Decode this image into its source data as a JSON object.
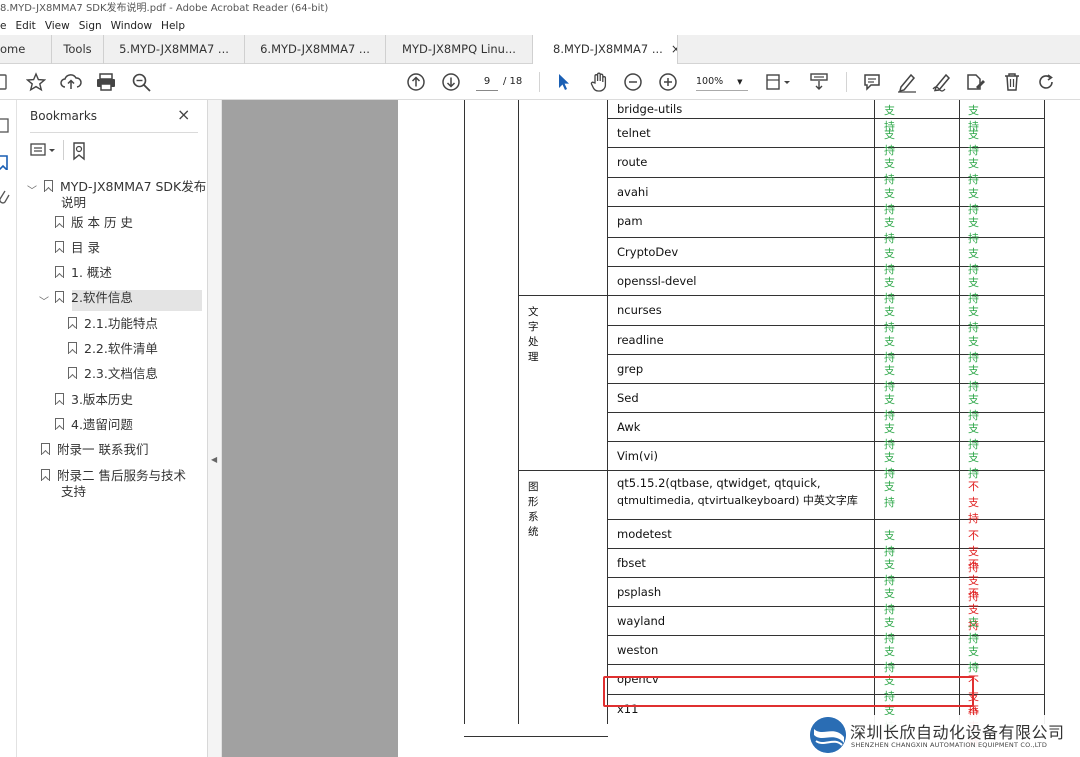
{
  "window": {
    "title": "8.MYD-JX8MMA7 SDK发布说明.pdf - Adobe Acrobat Reader (64-bit)"
  },
  "menu": [
    "e",
    "Edit",
    "View",
    "Sign",
    "Window",
    "Help"
  ],
  "tabs": [
    {
      "label": "ome"
    },
    {
      "label": "Tools"
    },
    {
      "label": "5.MYD-JX8MMA7 ..."
    },
    {
      "label": "6.MYD-JX8MMA7 ..."
    },
    {
      "label": "MYD-JX8MPQ Linu..."
    },
    {
      "label": "8.MYD-JX8MMA7 ..."
    }
  ],
  "tab_close": "×",
  "toolbar": {
    "page_current": "9",
    "page_total": "/ 18",
    "zoom": "100%"
  },
  "bookmarks": {
    "title": "Bookmarks",
    "close": "×",
    "items": [
      {
        "label": "MYD-JX8MMA7 SDK发布"
      },
      {
        "label": "说明"
      },
      {
        "label": "版 本 历 史"
      },
      {
        "label": "目 录"
      },
      {
        "label": "1. 概述"
      },
      {
        "label": "2.软件信息"
      },
      {
        "label": "2.1.功能特点"
      },
      {
        "label": "2.2.软件清单"
      },
      {
        "label": "2.3.文档信息"
      },
      {
        "label": "3.版本历史"
      },
      {
        "label": "4.遗留问题"
      },
      {
        "label": "附录一 联系我们"
      },
      {
        "label": "附录二 售后服务与技术"
      },
      {
        "label": "支持"
      }
    ]
  },
  "table": {
    "categories": [
      "文字处理",
      "图形系统"
    ],
    "rows": [
      {
        "name": "bridge-utils",
        "a": "支持",
        "b": "支持"
      },
      {
        "name": "telnet",
        "a": "支持",
        "b": "支持"
      },
      {
        "name": "route",
        "a": "支持",
        "b": "支持"
      },
      {
        "name": "avahi",
        "a": "支持",
        "b": "支持"
      },
      {
        "name": "pam",
        "a": "支持",
        "b": "支持"
      },
      {
        "name": "CryptoDev",
        "a": "支持",
        "b": "支持"
      },
      {
        "name": "openssl-devel",
        "a": "支持",
        "b": "支持"
      },
      {
        "name": "ncurses",
        "a": "支持",
        "b": "支持"
      },
      {
        "name": "readline",
        "a": "支持",
        "b": "支持"
      },
      {
        "name": "grep",
        "a": "支持",
        "b": "支持"
      },
      {
        "name": "Sed",
        "a": "支持",
        "b": "支持"
      },
      {
        "name": "Awk",
        "a": "支持",
        "b": "支持"
      },
      {
        "name": "Vim(vi)",
        "a": "支持",
        "b": "支持"
      },
      {
        "name": "qt5.15.2(qtbase, qtwidget, qtquick,",
        "name2": "qtmultimedia, qtvirtualkeyboard) 中英文字库",
        "a": "支持",
        "b": "不支持"
      },
      {
        "name": "modetest",
        "a": "支持",
        "b": "不支持"
      },
      {
        "name": "fbset",
        "a": "支持",
        "b": "不支持"
      },
      {
        "name": "psplash",
        "a": "支持",
        "b": "不支持"
      },
      {
        "name": "wayland",
        "a": "支持",
        "b": "支持"
      },
      {
        "name": "weston",
        "a": "支持",
        "b": "支持"
      },
      {
        "name": "opencv",
        "a": "支持",
        "b": "不支持"
      },
      {
        "name": "x11",
        "a": "支持",
        "b": "不支持"
      }
    ]
  },
  "watermark": {
    "cn": "深圳长欣自动化设备有限公司",
    "en": "SHENZHEN CHANGXIN AUTOMATION EQUIPMENT CO.,LTD"
  },
  "colors": {
    "support": "#2fa84a",
    "unsupported": "#e02020",
    "highlight": "#e03030"
  }
}
